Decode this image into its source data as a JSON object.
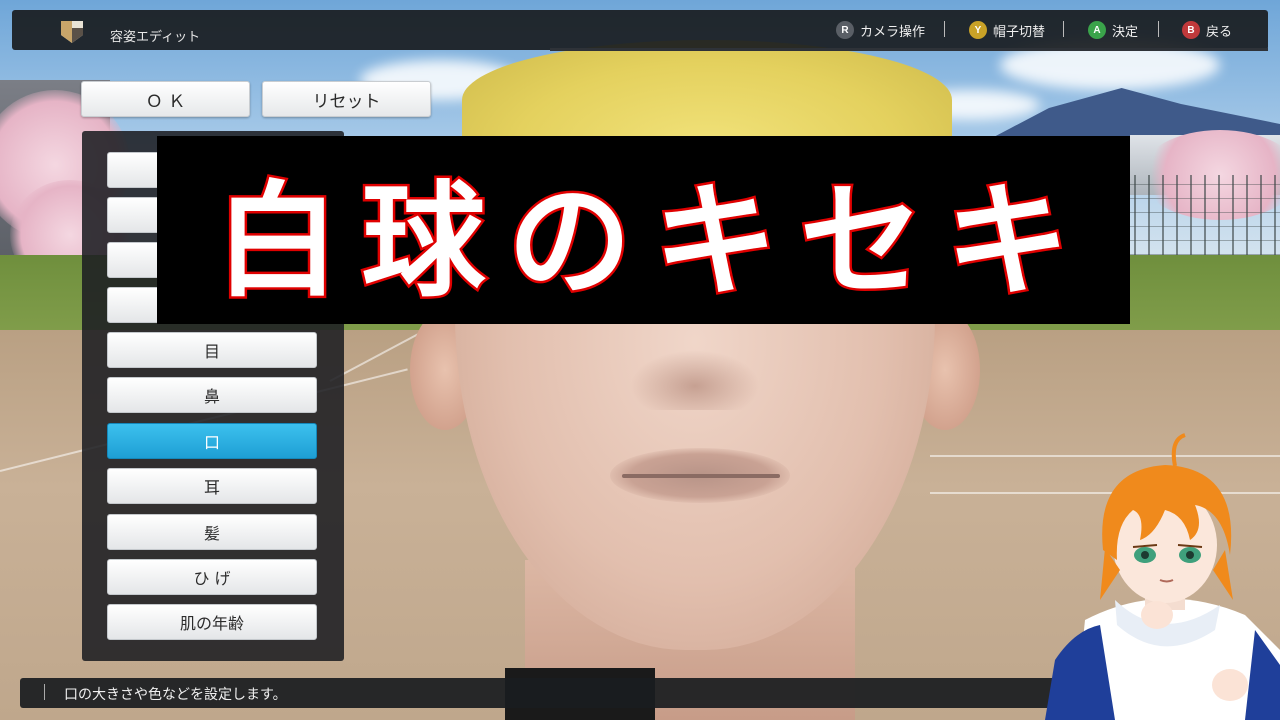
{
  "header": {
    "title": "容姿エディット",
    "hints": [
      {
        "button": "R",
        "label": "カメラ操作",
        "color": "#5a5f66"
      },
      {
        "button": "Y",
        "label": "帽子切替",
        "color": "#c9a227"
      },
      {
        "button": "A",
        "label": "決定",
        "color": "#3aa34a"
      },
      {
        "button": "B",
        "label": "戻る",
        "color": "#c0393b"
      }
    ]
  },
  "buttons": {
    "ok_label": "Ｏ Ｋ",
    "reset_label": "リセット"
  },
  "menu": {
    "items": [
      {
        "label": "目"
      },
      {
        "label": "鼻"
      },
      {
        "label": "口",
        "selected": true
      },
      {
        "label": "耳"
      },
      {
        "label": "髪"
      },
      {
        "label": "ひ げ"
      },
      {
        "label": "肌の年齢"
      }
    ]
  },
  "overlay": {
    "title": "白球のキセキ"
  },
  "description": {
    "text": "口の大きさや色などを設定します。"
  },
  "colors": {
    "accent": "#1e9fd4",
    "overlay_stroke": "#e00000"
  }
}
